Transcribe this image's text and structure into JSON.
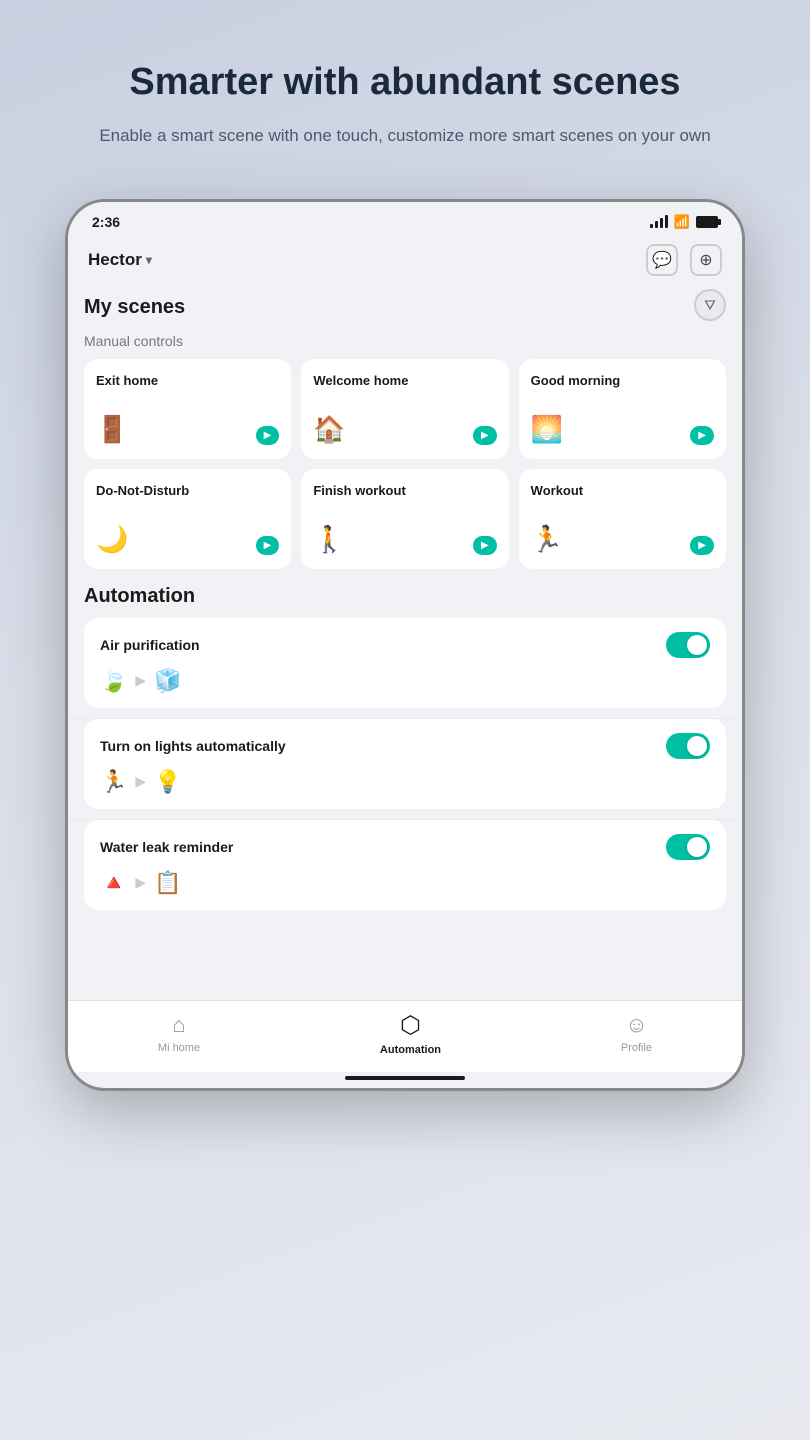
{
  "page": {
    "headline": "Smarter with abundant scenes",
    "subtext": "Enable a smart scene with one touch, customize more smart scenes on your own"
  },
  "status_bar": {
    "time": "2:36"
  },
  "header": {
    "user": "Hector",
    "chevron": "▾"
  },
  "scenes": {
    "title": "My scenes",
    "manual_controls_label": "Manual controls",
    "items": [
      {
        "label": "Exit home",
        "icon": "🚪"
      },
      {
        "label": "Welcome home",
        "icon": "🏠"
      },
      {
        "label": "Good morning",
        "icon": "🌅"
      },
      {
        "label": "Do-Not-Disturb",
        "icon": "🌙"
      },
      {
        "label": "Finish workout",
        "icon": "🚶"
      },
      {
        "label": "Workout",
        "icon": "🏃"
      }
    ]
  },
  "automation": {
    "title": "Automation",
    "items": [
      {
        "label": "Air purification",
        "trigger_icon": "🍃",
        "action_icon": "🧊",
        "enabled": true
      },
      {
        "label": "Turn on lights automatically",
        "trigger_icon": "🏃",
        "action_icon": "💡",
        "enabled": true
      },
      {
        "label": "Water leak reminder",
        "trigger_icon": "🔺",
        "action_icon": "📋",
        "enabled": true
      }
    ]
  },
  "bottom_nav": {
    "items": [
      {
        "label": "Mi home",
        "icon": "🏠",
        "active": false
      },
      {
        "label": "Automation",
        "icon": "⬡",
        "active": true
      },
      {
        "label": "Profile",
        "icon": "☺",
        "active": false
      }
    ]
  }
}
